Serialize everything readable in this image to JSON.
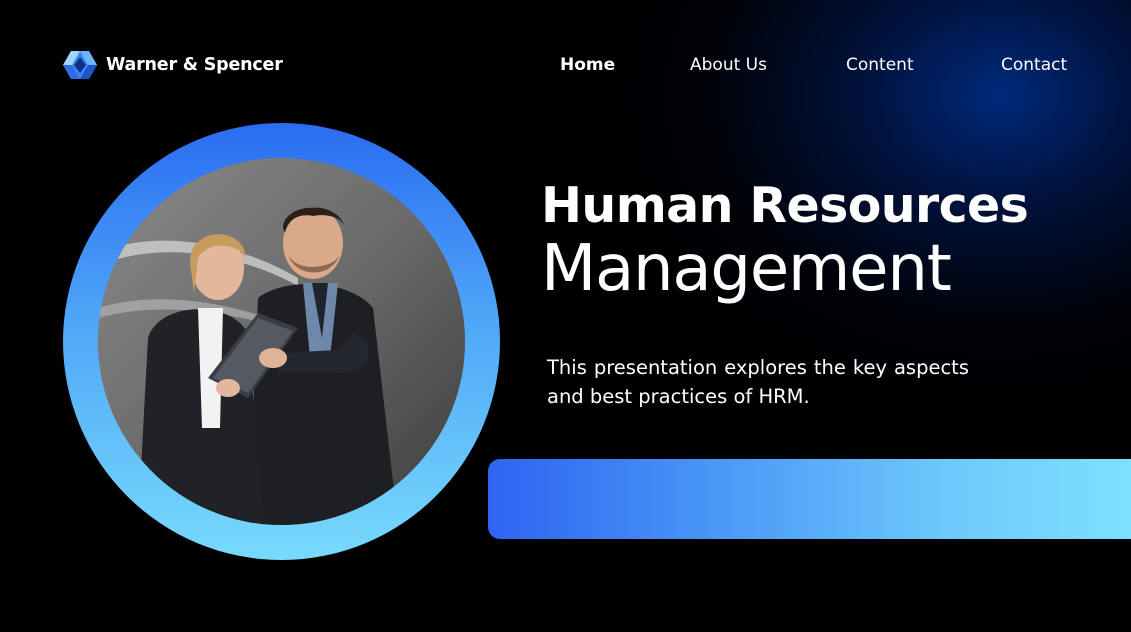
{
  "brand": {
    "name": "Warner & Spencer",
    "logo_icon": "hexagon-cube-icon"
  },
  "nav": {
    "items": [
      {
        "label": "Home",
        "active": true
      },
      {
        "label": "About Us",
        "active": false
      },
      {
        "label": "Content",
        "active": false
      },
      {
        "label": "Contact",
        "active": false
      }
    ]
  },
  "hero": {
    "title_line1": "Human Resources",
    "title_line2": "Management",
    "description": "This presentation explores the key aspects and best practices of HRM."
  },
  "colors": {
    "background": "#000000",
    "glow": "#00308f",
    "ring_top": "#2a6cf2",
    "ring_bottom": "#78dafc",
    "bar_start": "#2d64f1",
    "bar_end": "#7fe3ff",
    "logo_light": "#8ec8ff",
    "logo_dark": "#2a64e0"
  }
}
